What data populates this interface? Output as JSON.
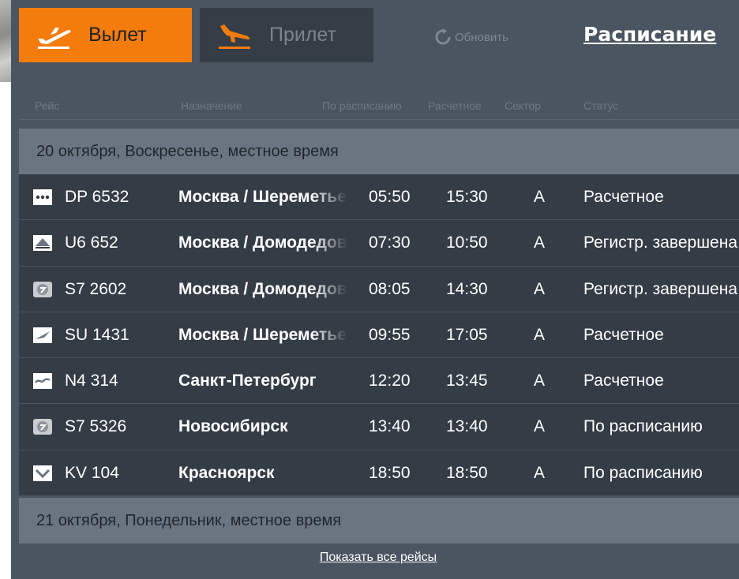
{
  "tabs": {
    "departure": {
      "label": "Вылет",
      "icon": "plane-takeoff-icon"
    },
    "arrival": {
      "label": "Прилет",
      "icon": "plane-landing-icon"
    }
  },
  "refresh": {
    "label": "Обновить",
    "icon": "refresh-icon"
  },
  "schedule_link": "Расписание",
  "columns": [
    "Рейс",
    "Назначение",
    "По расписанию",
    "Расчетное",
    "Сектор",
    "Статус"
  ],
  "dates": [
    "20 октября, Воскресенье, местное время",
    "21 октября, Понедельник, местное время"
  ],
  "flights": [
    {
      "flight": "DP 6532",
      "destination": "Москва / Шереметьево",
      "scheduled": "05:50",
      "estimated": "15:30",
      "sector": "A",
      "status": "Расчетное",
      "logo": "pobeda-logo"
    },
    {
      "flight": "U6 652",
      "destination": "Москва / Домодедово",
      "scheduled": "07:30",
      "estimated": "10:50",
      "sector": "A",
      "status": "Регистр. завершена",
      "logo": "ural-airlines-logo"
    },
    {
      "flight": "S7 2602",
      "destination": "Москва / Домодедово",
      "scheduled": "08:05",
      "estimated": "14:30",
      "sector": "A",
      "status": "Регистр. завершена",
      "logo": "s7-logo"
    },
    {
      "flight": "SU 1431",
      "destination": "Москва / Шереметьево",
      "scheduled": "09:55",
      "estimated": "17:05",
      "sector": "A",
      "status": "Расчетное",
      "logo": "aeroflot-logo"
    },
    {
      "flight": "N4 314",
      "destination": "Санкт-Петербург",
      "scheduled": "12:20",
      "estimated": "13:45",
      "sector": "A",
      "status": "Расчетное",
      "logo": "nordwind-logo"
    },
    {
      "flight": "S7 5326",
      "destination": "Новосибирск",
      "scheduled": "13:40",
      "estimated": "13:40",
      "sector": "A",
      "status": "По расписанию",
      "logo": "s7-logo"
    },
    {
      "flight": "KV 104",
      "destination": "Красноярск",
      "scheduled": "18:50",
      "estimated": "18:50",
      "sector": "A",
      "status": "По расписанию",
      "logo": "krasavia-logo"
    }
  ],
  "show_all": "Показать все рейсы",
  "colors": {
    "accent": "#f47c0d",
    "board": "#4b5562",
    "row": "#343c45",
    "date_bar": "#6b7581"
  }
}
